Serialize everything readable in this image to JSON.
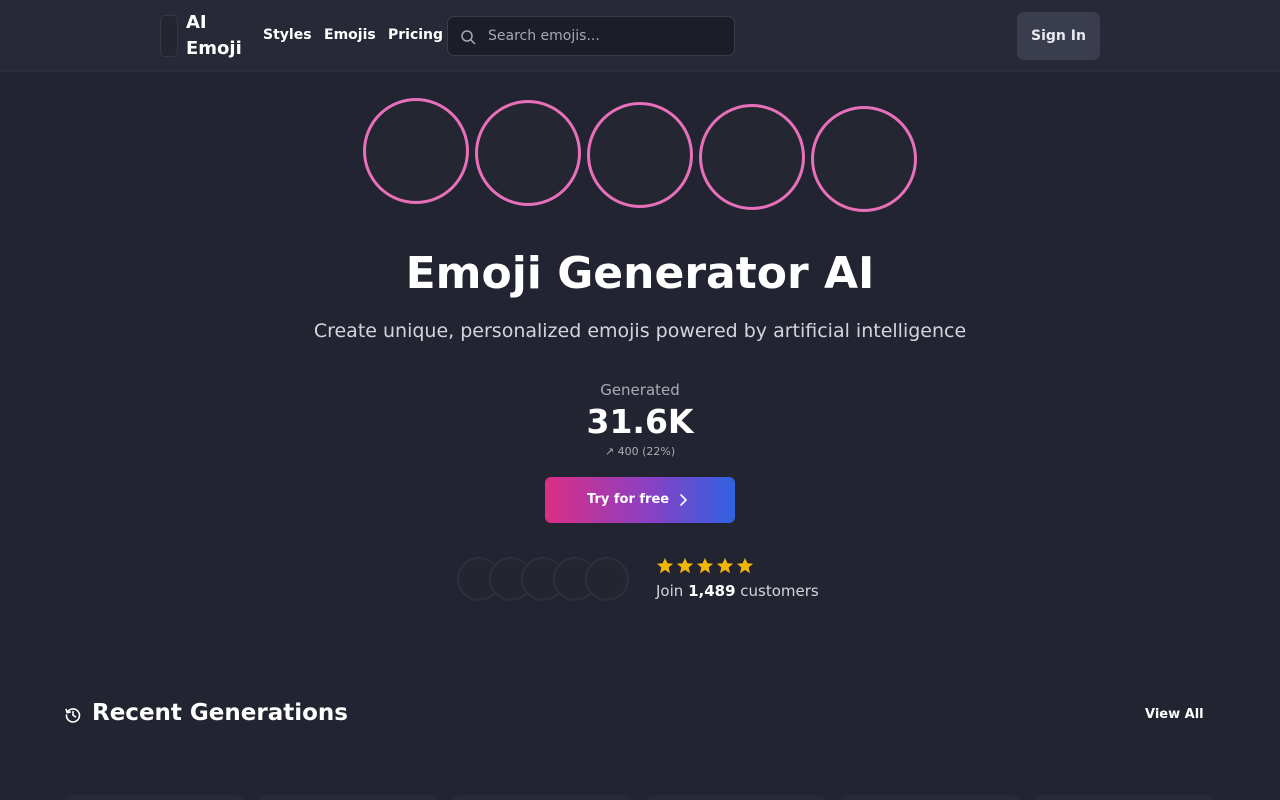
{
  "header": {
    "logo_text": "AI Emoji",
    "nav": [
      "Styles",
      "Emojis",
      "Pricing"
    ],
    "search_placeholder": "Search emojis...",
    "signin_label": "Sign In"
  },
  "hero": {
    "title": "Emoji Generator AI",
    "subtitle": "Create unique, personalized emojis powered by artificial intelligence",
    "stat_label": "Generated",
    "stat_value": "31.6K",
    "stat_change": "↗ 400 (22%)",
    "cta_label": "Try for free"
  },
  "social_proof": {
    "rating_stars": 5,
    "join_prefix": "Join",
    "join_count": "1,489",
    "join_suffix": "customers"
  },
  "recent": {
    "title": "Recent Generations",
    "view_all": "View All"
  },
  "colors": {
    "background": "#222531",
    "accent_pink": "#e86fb9",
    "star": "#f2b705",
    "cta_gradient_start": "#da2f83",
    "cta_gradient_end": "#2f62e2"
  },
  "icons": [
    "search-icon",
    "chevron-right-icon",
    "star-icon",
    "history-icon"
  ]
}
